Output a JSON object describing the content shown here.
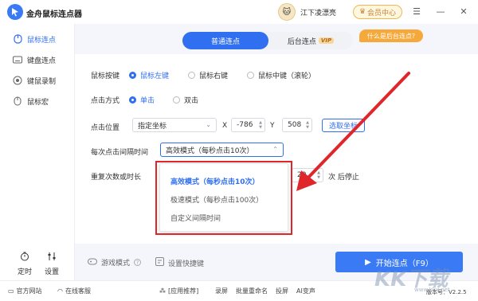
{
  "app": {
    "title": "金舟鼠标连点器",
    "username": "江下凌漂亮",
    "member_label": "会员中心"
  },
  "sidebar": {
    "items": [
      {
        "label": "鼠标连点",
        "icon": "mouse-click-icon",
        "active": true
      },
      {
        "label": "键盘连点",
        "icon": "keyboard-icon",
        "active": false
      },
      {
        "label": "键鼠录制",
        "icon": "record-icon",
        "active": false
      },
      {
        "label": "鼠标宏",
        "icon": "mouse-macro-icon",
        "active": false
      }
    ],
    "bottom": [
      {
        "label": "定时",
        "icon": "timer-icon"
      },
      {
        "label": "设置",
        "icon": "settings-icon"
      }
    ]
  },
  "tabs": {
    "normal": "普通连点",
    "background": "后台连点",
    "vip": "VIP",
    "hint": "什么是后台连点?"
  },
  "form": {
    "mouse_button_label": "鼠标按键",
    "mouse_buttons": [
      "鼠标左键",
      "鼠标右键",
      "鼠标中键（滚轮）"
    ],
    "click_mode_label": "点击方式",
    "click_modes": [
      "单击",
      "双击"
    ],
    "position_label": "点击位置",
    "position_select": "指定坐标",
    "x_label": "X",
    "x_value": "-786",
    "y_label": "Y",
    "y_value": "508",
    "pick_button": "选取坐标",
    "interval_label": "每次点击间隔时间",
    "interval_select": "高效模式（每秒点击10次）",
    "repeat_label": "重复次数或时长",
    "repeat_value": "20",
    "repeat_suffix": "次 后停止"
  },
  "dropdown": {
    "options": [
      "高效模式（每秒点击10次）",
      "极速模式（每秒点击100次）",
      "自定义间隔时间"
    ],
    "selected_index": 0
  },
  "actions": {
    "game_mode": "游戏模式",
    "shortcut": "设置快捷键",
    "start": "开始连点（F9）"
  },
  "footer": {
    "website": "官方网站",
    "support": "在线客服",
    "recommend": "[应用推荐]",
    "links": [
      "录屏",
      "批量重命名",
      "投屏",
      "AI变声"
    ],
    "version_label": "版本号：V2.2.5"
  },
  "watermark": {
    "text": "KK下载",
    "sub": "www.kkx.net"
  },
  "colors": {
    "accent": "#2f6ff0",
    "highlight": "#e0262b",
    "vip": "#f7d79b"
  }
}
